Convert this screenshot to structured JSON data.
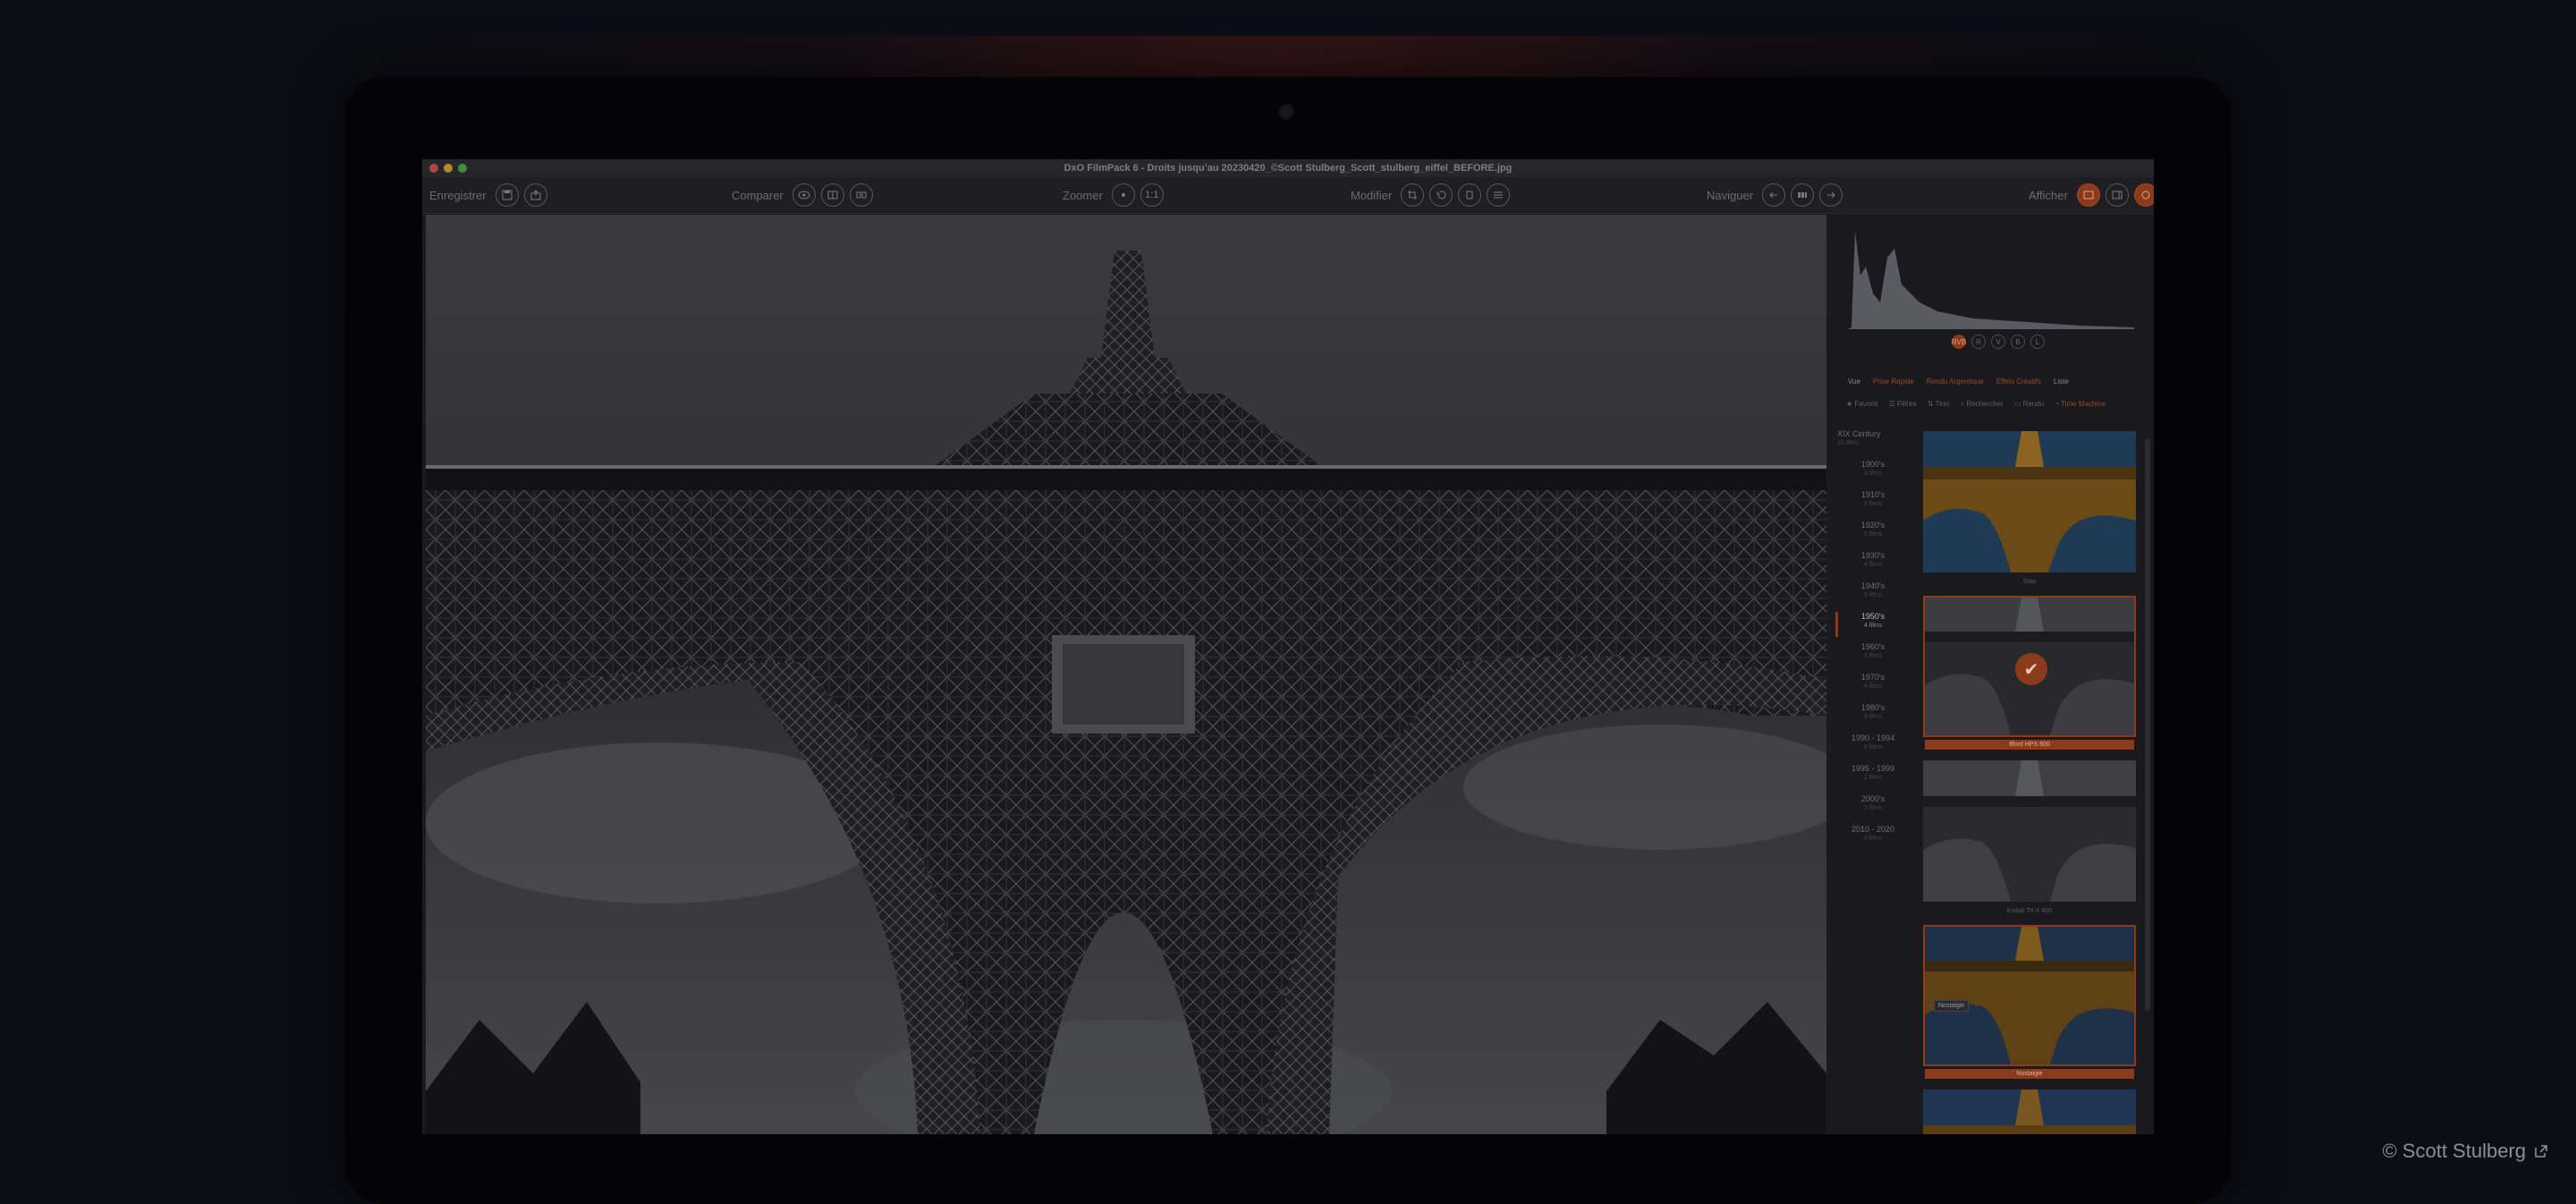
{
  "window": {
    "title": "DxO FilmPack 6 - Droits jusqu’au 20230420_©Scott Stulberg_Scott_stulberg_eiffel_BEFORE.jpg"
  },
  "toolbar": {
    "save": {
      "label": "Enregistrer"
    },
    "compare": {
      "label": "Comparer"
    },
    "zoom": {
      "label": "Zoomer",
      "ratio": "1:1"
    },
    "modify": {
      "label": "Modifier"
    },
    "navigate": {
      "label": "Naviguer"
    },
    "display": {
      "label": "Afficher"
    }
  },
  "histogram": {
    "channels": [
      "RVB",
      "R",
      "V",
      "B",
      "L"
    ],
    "active": "RVB"
  },
  "filters": [
    "Vue",
    "Prise Rapide",
    "Rendu Argentique",
    "Effets Créatifs",
    "Liste"
  ],
  "subtabs": [
    "Favoris",
    "Filtres",
    "Tirer",
    "Rechercher",
    "Rendu",
    "Time Machine"
  ],
  "timemachine": {
    "decades": [
      {
        "label": "XIX Century",
        "count": "10 films"
      },
      {
        "label": "1900's",
        "count": "3 films"
      },
      {
        "label": "1910's",
        "count": "3 films"
      },
      {
        "label": "1920's",
        "count": "5 films"
      },
      {
        "label": "1930's",
        "count": "4 films"
      },
      {
        "label": "1940's",
        "count": "3 films"
      },
      {
        "label": "1950's",
        "count": "4 films"
      },
      {
        "label": "1960's",
        "count": "3 films"
      },
      {
        "label": "1970's",
        "count": "4 films"
      },
      {
        "label": "1980's",
        "count": "3 films"
      },
      {
        "label": "1990 - 1994",
        "count": "2 films"
      },
      {
        "label": "1995 - 1999",
        "count": "2 films"
      },
      {
        "label": "2000's",
        "count": "3 films"
      },
      {
        "label": "2010 - 2020",
        "count": "3 films"
      }
    ],
    "selected": "1950's",
    "thumbnails": [
      {
        "caption": "Stop"
      },
      {
        "caption": "Ilford HPS 800"
      },
      {
        "caption": "Kodak Tri-X 400"
      },
      {
        "caption": "Nostalgie",
        "tooltip": "Nostalgie"
      }
    ]
  },
  "credit": {
    "text": "© Scott Stulberg"
  },
  "colors": {
    "accent": "#8b3b1c",
    "background": "#0c0d16"
  }
}
